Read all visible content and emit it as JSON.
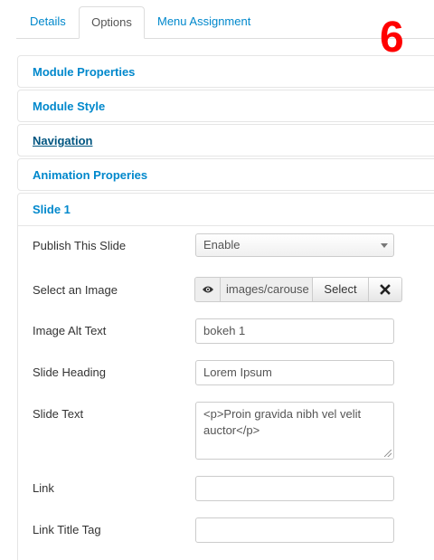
{
  "tabs": [
    {
      "label": "Details"
    },
    {
      "label": "Options",
      "active": true
    },
    {
      "label": "Menu Assignment"
    }
  ],
  "badge": "6",
  "sections": [
    {
      "title": "Module Properties"
    },
    {
      "title": "Module Style"
    },
    {
      "title": "Navigation"
    },
    {
      "title": "Animation Properies"
    },
    {
      "title": "Slide 1"
    }
  ],
  "slide": {
    "publish": {
      "label": "Publish This Slide",
      "value": "Enable"
    },
    "image": {
      "label": "Select an Image",
      "path": "images/carouse",
      "select_label": "Select",
      "preview_icon": "eye-icon",
      "clear_icon": "close-icon"
    },
    "alt": {
      "label": "Image Alt Text",
      "value": "bokeh 1"
    },
    "heading": {
      "label": "Slide Heading",
      "value": "Lorem Ipsum"
    },
    "text": {
      "label": "Slide Text",
      "value": "<p>Proin gravida nibh vel velit auctor</p>"
    },
    "link": {
      "label": "Link",
      "value": ""
    },
    "link_title": {
      "label": "Link Title Tag",
      "value": ""
    }
  },
  "colors": {
    "link": "#0088cc",
    "badge": "#ff0000"
  }
}
